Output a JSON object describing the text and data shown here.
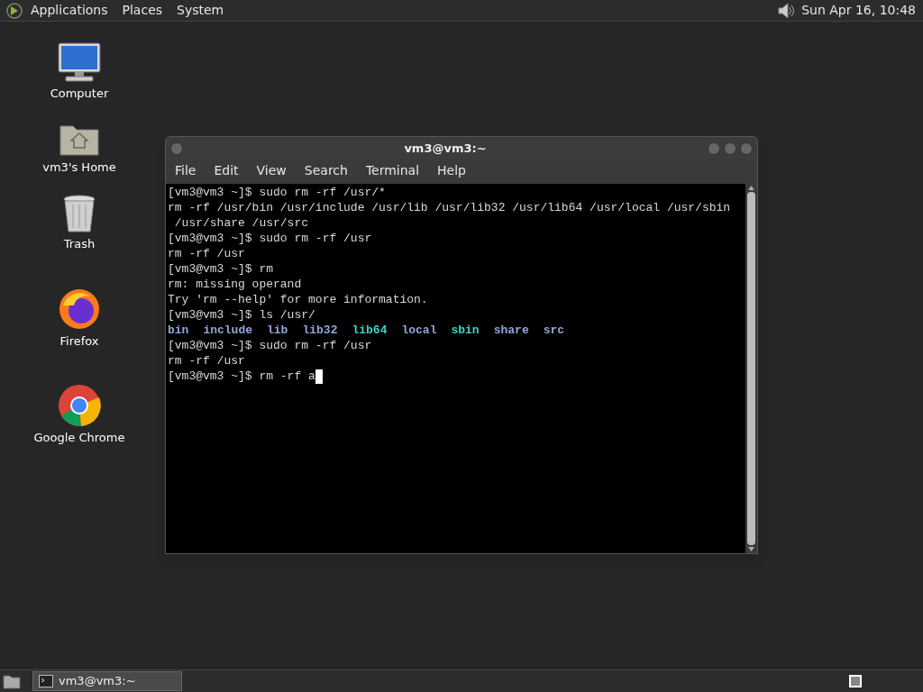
{
  "top_panel": {
    "menus": [
      "Applications",
      "Places",
      "System"
    ],
    "clock": "Sun Apr 16, 10:48"
  },
  "desktop_icons": [
    {
      "kind": "computer",
      "label": "Computer"
    },
    {
      "kind": "home",
      "label": "vm3's Home"
    },
    {
      "kind": "trash",
      "label": "Trash"
    },
    {
      "kind": "firefox",
      "label": "Firefox"
    },
    {
      "kind": "chrome",
      "label": "Google Chrome"
    }
  ],
  "terminal_window": {
    "title": "vm3@vm3:~",
    "menus": [
      "File",
      "Edit",
      "View",
      "Search",
      "Terminal",
      "Help"
    ],
    "lines": [
      {
        "kind": "text",
        "text": "[vm3@vm3 ~]$ sudo rm -rf /usr/*"
      },
      {
        "kind": "text",
        "text": "rm -rf /usr/bin /usr/include /usr/lib /usr/lib32 /usr/lib64 /usr/local /usr/sbin"
      },
      {
        "kind": "text",
        "text": " /usr/share /usr/src"
      },
      {
        "kind": "text",
        "text": "[vm3@vm3 ~]$ sudo rm -rf /usr"
      },
      {
        "kind": "text",
        "text": "rm -rf /usr"
      },
      {
        "kind": "text",
        "text": "[vm3@vm3 ~]$ rm"
      },
      {
        "kind": "text",
        "text": "rm: missing operand"
      },
      {
        "kind": "text",
        "text": "Try 'rm --help' for more information."
      },
      {
        "kind": "text",
        "text": "[vm3@vm3 ~]$ ls /usr/"
      },
      {
        "kind": "listing",
        "items": [
          {
            "text": "bin",
            "color": "#8fa6d6"
          },
          {
            "text": "include",
            "color": "#8fa6d6"
          },
          {
            "text": "lib",
            "color": "#8fa6d6"
          },
          {
            "text": "lib32",
            "color": "#8fa6d6"
          },
          {
            "text": "lib64",
            "color": "#3fd1c4"
          },
          {
            "text": "local",
            "color": "#8fa6d6"
          },
          {
            "text": "sbin",
            "color": "#3fd1c4"
          },
          {
            "text": "share",
            "color": "#8fa6d6"
          },
          {
            "text": "src",
            "color": "#8fa6d6"
          }
        ]
      },
      {
        "kind": "text",
        "text": "[vm3@vm3 ~]$ sudo rm -rf /usr"
      },
      {
        "kind": "text",
        "text": "rm -rf /usr"
      },
      {
        "kind": "prompt",
        "text": "[vm3@vm3 ~]$ rm -rf a"
      }
    ]
  },
  "taskbar": {
    "tasks": [
      {
        "label": "vm3@vm3:~",
        "selected": true
      }
    ]
  }
}
